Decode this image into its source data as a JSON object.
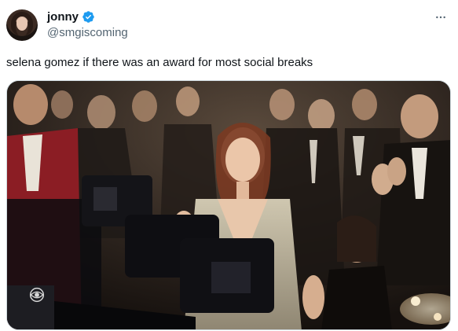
{
  "tweet": {
    "display_name": "jonny",
    "handle": "@smgiscoming",
    "text": "selena gomez if there was an award for most social breaks",
    "verified": true,
    "icons": {
      "verified": "verified-badge-icon",
      "more": "more-horizontal-icon",
      "watermark": "cbs-eye-logo"
    }
  },
  "colors": {
    "verified_blue": "#1d9bf0",
    "secondary_text": "#536471"
  }
}
